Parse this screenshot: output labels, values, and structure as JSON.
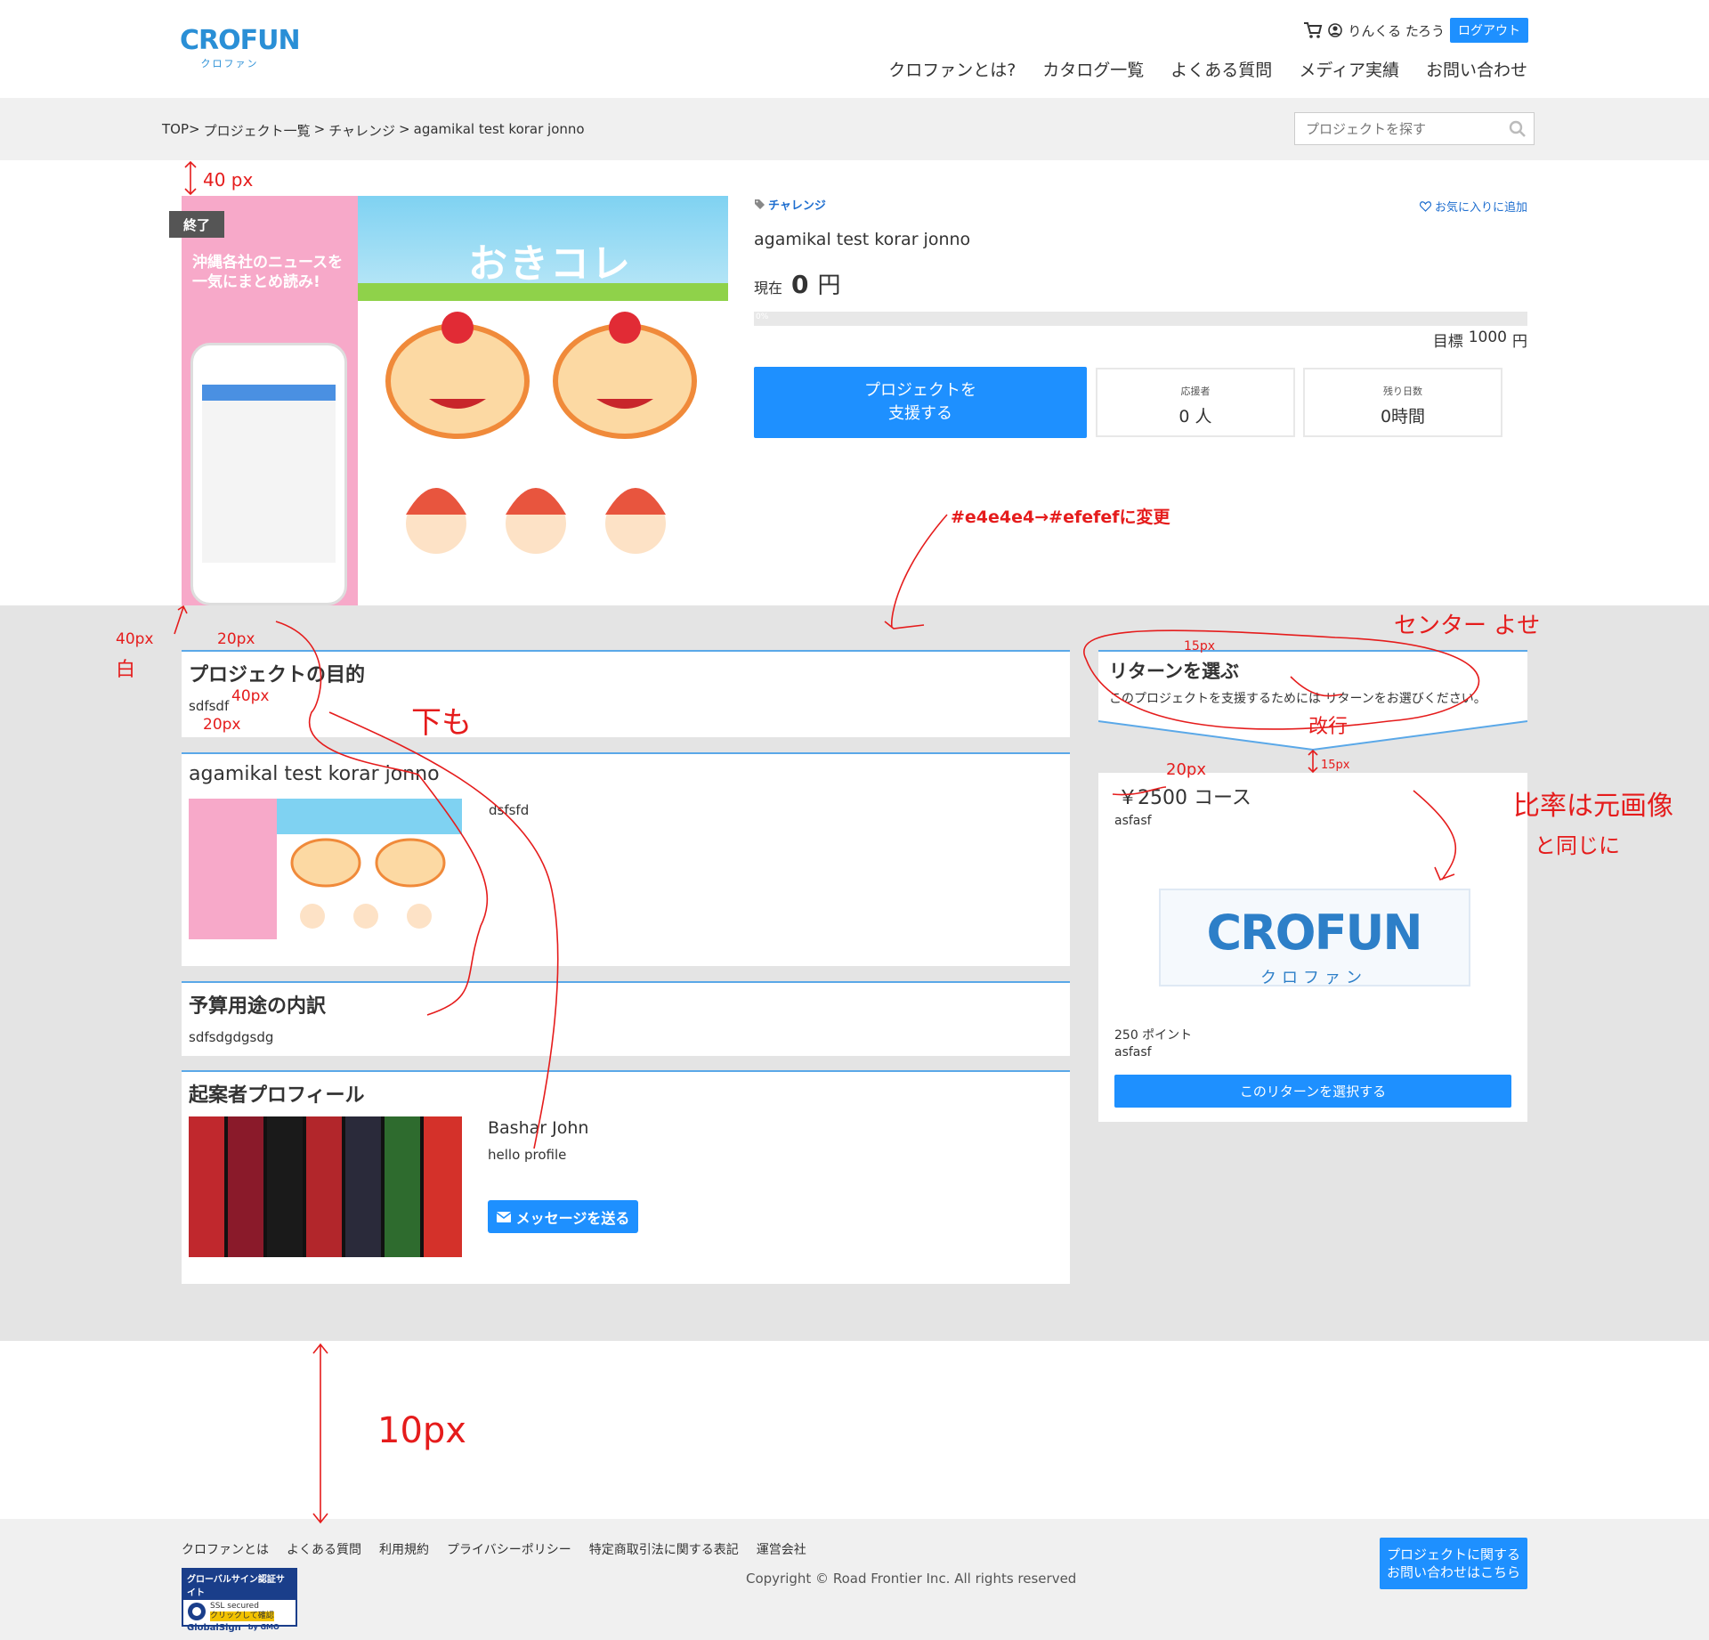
{
  "header": {
    "logo_text": "CROFUN",
    "logo_kana": "クロファン",
    "user_name": "りんくる たろう",
    "logout_label": "ログアウト",
    "nav": [
      "クロファンとは?",
      "カタログ一覧",
      "よくある質問",
      "メディア実績",
      "お問い合わせ"
    ]
  },
  "breadcrumb": {
    "items": [
      "TOP>",
      "プロジェクト一覧",
      ">",
      "チャレンジ",
      ">",
      "agamikal test korar jonno"
    ]
  },
  "search": {
    "placeholder": "プロジェクトを探す"
  },
  "hero": {
    "status_badge": "終了",
    "image_banner_text": "おきコレ",
    "image_side_text_1": "沖縄各社のニュースを",
    "image_side_text_2": "一気にまとめ読み!"
  },
  "project": {
    "category": "チャレンジ",
    "favorite_label": "お気に入りに追加",
    "title": "agamikal test korar jonno",
    "current_label": "現在",
    "current_amount": "0",
    "currency": "円",
    "progress_percent": 0,
    "progress_label": "0%",
    "goal_label": "目標",
    "goal_amount": "1000",
    "goal_currency": "円",
    "support_button_line1": "プロジェクトを",
    "support_button_line2": "支援する",
    "supporters_label": "応援者",
    "supporters_value": "0 人",
    "remaining_label": "残り日数",
    "remaining_value": "0時間"
  },
  "sections": {
    "purpose_title": "プロジェクトの目的",
    "purpose_body": "sdfsdf",
    "detail_title": "agamikal test korar jonno",
    "detail_body": "dsfsfd",
    "budget_title": "予算用途の内訳",
    "budget_body": "sdfsdgdgsdg",
    "profile_title": "起案者プロフィール",
    "profile_name": "Bashar John",
    "profile_text": "hello profile",
    "message_button": "メッセージを送る"
  },
  "returns": {
    "title": "リターンを選ぶ",
    "subtitle": "このプロジェクトを支援するためには リターンをお選びください。",
    "course_title": "￥2500 コース",
    "course_desc": "asfasf",
    "course_image_text": "CROFUN",
    "course_image_kana": "クロファン",
    "course_points": "250 ポイント",
    "course_desc2": "asfasf",
    "select_button": "このリターンを選択する"
  },
  "footer": {
    "links": [
      "クロファンとは",
      "よくある質問",
      "利用規約",
      "プライバシーポリシー",
      "特定商取引法に関する表記",
      "運営会社"
    ],
    "copyright": "Copyright © Road Frontier Inc. All rights reserved",
    "contact_line1": "プロジェクトに関する",
    "contact_line2": "お問い合わせはこちら",
    "seal_title": "グローバルサイン認証サイト",
    "seal_ssl": "SSL secured",
    "seal_click": "クリックして確認",
    "seal_brand": "GlobalSign",
    "seal_by": "by GMO"
  },
  "annotations": {
    "a_40px_top": "40 px",
    "a_color_change": "#e4e4e4→#efefefに変更",
    "a_center": "センター よせ",
    "a_40px_side": "40px",
    "a_white": "白",
    "a_20px_a": "20px",
    "a_40px_b": "40px",
    "a_20px_b": "20px",
    "a_shita_mo": "下も",
    "a_15px_a": "15px",
    "a_kaigyo": "改行",
    "a_20px_c": "20px",
    "a_15px_b": "15px",
    "a_ratio_1": "比率は元画像",
    "a_ratio_2": "と同じに",
    "a_10px": "10px"
  },
  "colors": {
    "accent": "#1e90ff",
    "annotation": "#e51c1c",
    "band_gray": "#e4e4e4",
    "card_border": "#5aa8e8"
  }
}
